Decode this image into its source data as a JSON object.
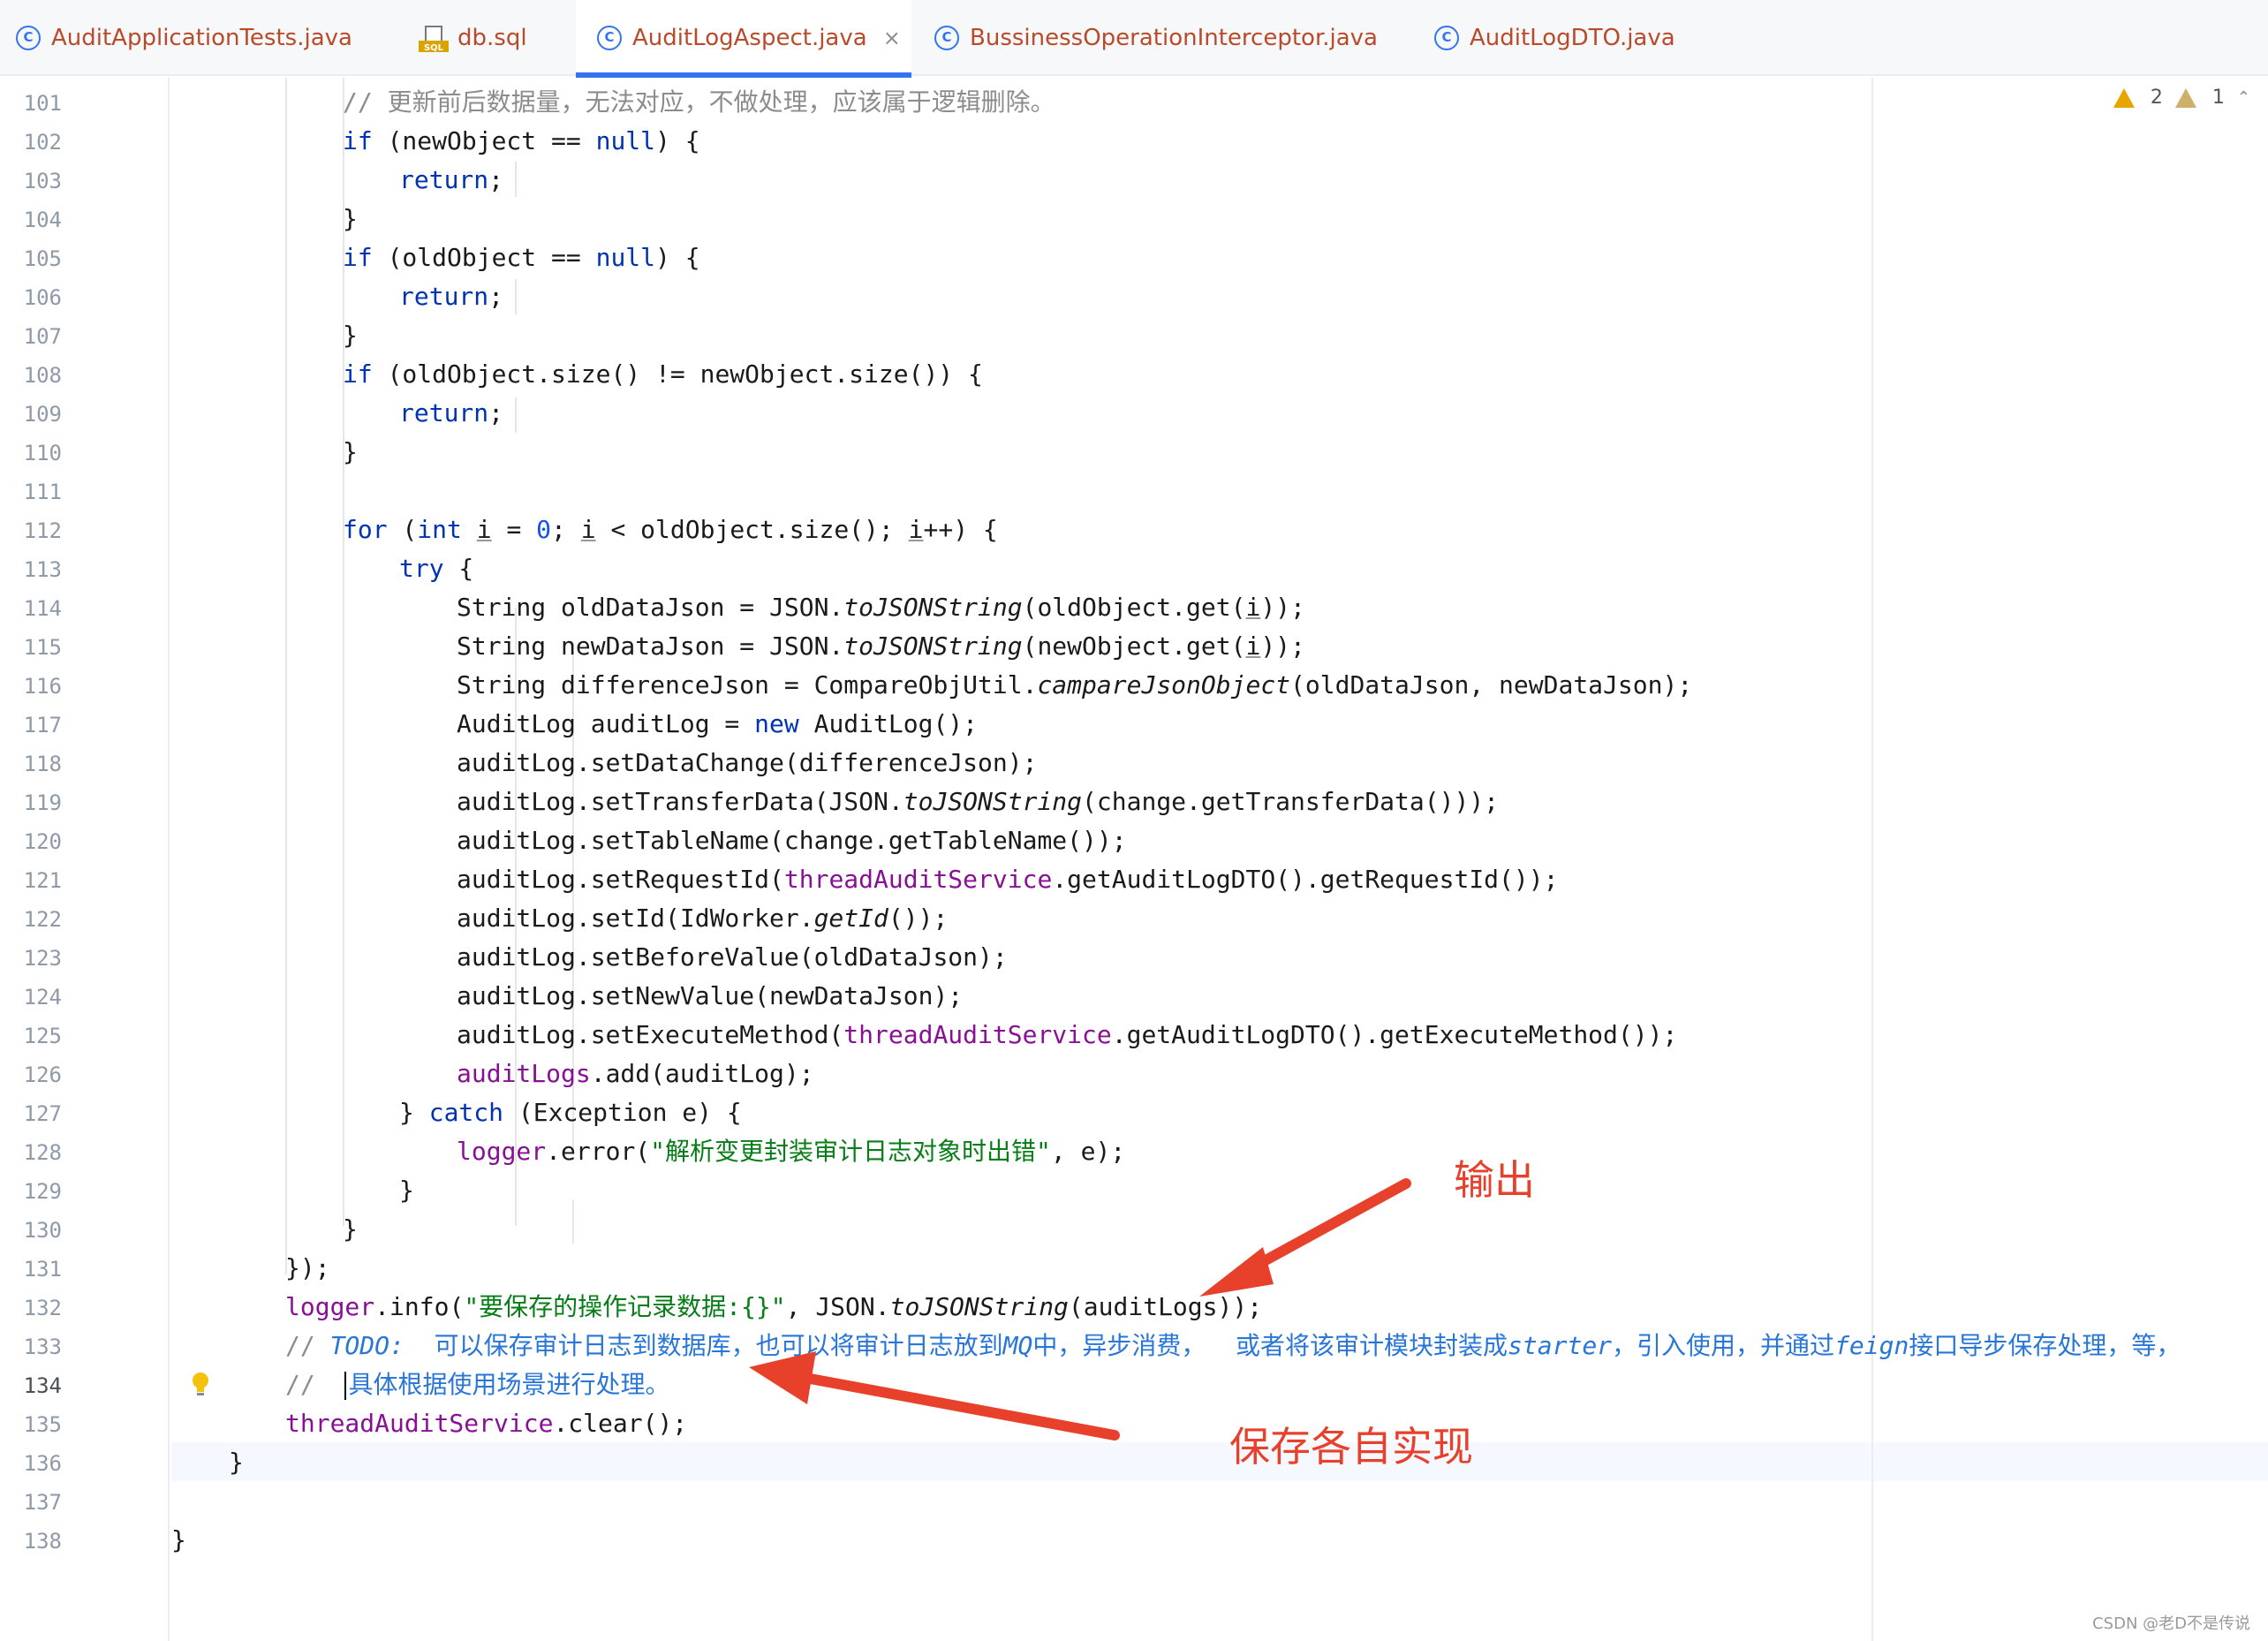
{
  "tabs": [
    {
      "label": "AuditApplicationTests.java",
      "icon": "class-icon",
      "active": false
    },
    {
      "label": "db.sql",
      "icon": "sql-file-icon",
      "active": false
    },
    {
      "label": "AuditLogAspect.java",
      "icon": "class-icon",
      "active": true
    },
    {
      "label": "BussinessOperationInterceptor.java",
      "icon": "class-icon",
      "active": false
    },
    {
      "label": "AuditLogDTO.java",
      "icon": "class-icon",
      "active": false
    }
  ],
  "class_icon_glyph": "C",
  "close_glyph": "×",
  "inspection": {
    "warnings": "2",
    "weak_warnings": "1"
  },
  "line_numbers": [
    "101",
    "102",
    "103",
    "104",
    "105",
    "106",
    "107",
    "108",
    "109",
    "110",
    "111",
    "112",
    "113",
    "114",
    "115",
    "116",
    "117",
    "118",
    "119",
    "120",
    "121",
    "122",
    "123",
    "124",
    "125",
    "126",
    "127",
    "128",
    "129",
    "130",
    "131",
    "132",
    "133",
    "134",
    "135",
    "136",
    "137",
    "138"
  ],
  "current_line": "134",
  "code": {
    "l101": "// 更新前后数据量，无法对应，不做处理，应该属于逻辑删除。",
    "l102a": "if",
    "l102b": " (newObject == ",
    "l102c": "null",
    "l102d": ") {",
    "l103": "return",
    "l103b": ";",
    "l104": "}",
    "l105a": "if",
    "l105b": " (oldObject == ",
    "l105c": "null",
    "l105d": ") {",
    "l106": "return",
    "l106b": ";",
    "l107": "}",
    "l108a": "if",
    "l108b": " (oldObject.size() != newObject.size()) {",
    "l109": "return",
    "l109b": ";",
    "l110": "}",
    "l112a": "for",
    "l112b": " (",
    "l112c": "int",
    "l112d": " ",
    "l112e": "i",
    "l112f": " = ",
    "l112g": "0",
    "l112h": "; ",
    "l112i": "i",
    "l112j": " < oldObject.size(); ",
    "l112k": "i",
    "l112l": "++) {",
    "l113a": "try",
    "l113b": " {",
    "l114a": "String oldDataJson = JSON.",
    "l114b": "toJSONString",
    "l114c": "(oldObject.get(",
    "l114d": "i",
    "l114e": "));",
    "l115a": "String newDataJson = JSON.",
    "l115b": "toJSONString",
    "l115c": "(newObject.get(",
    "l115d": "i",
    "l115e": "));",
    "l116a": "String differenceJson = CompareObjUtil.",
    "l116b": "campareJsonObject",
    "l116c": "(oldDataJson, newDataJson);",
    "l117a": "AuditLog auditLog = ",
    "l117b": "new",
    "l117c": " AuditLog();",
    "l118": "auditLog.setDataChange(differenceJson);",
    "l119a": "auditLog.setTransferData(JSON.",
    "l119b": "toJSONString",
    "l119c": "(change.getTransferData()));",
    "l120": "auditLog.setTableName(change.getTableName());",
    "l121a": "auditLog.setRequestId(",
    "l121b": "threadAuditService",
    "l121c": ".getAuditLogDTO().getRequestId());",
    "l122a": "auditLog.setId(IdWorker.",
    "l122b": "getId",
    "l122c": "());",
    "l123": "auditLog.setBeforeValue(oldDataJson);",
    "l124": "auditLog.setNewValue(newDataJson);",
    "l125a": "auditLog.setExecuteMethod(",
    "l125b": "threadAuditService",
    "l125c": ".getAuditLogDTO().getExecuteMethod());",
    "l126a": "auditLogs",
    "l126b": ".add(auditLog);",
    "l127a": "} ",
    "l127b": "catch",
    "l127c": " (Exception e) {",
    "l128a": "logger",
    "l128b": ".error(",
    "l128c": "\"解析变更封装审计日志对象时出错\"",
    "l128d": ", e);",
    "l129": "}",
    "l130": "}",
    "l131": "});",
    "l132a": "logger",
    "l132b": ".info(",
    "l132c": "\"要保存的操作记录数据:{}\"",
    "l132d": ", JSON.",
    "l132e": "toJSONString",
    "l132f": "(auditLogs));",
    "l133a": "// ",
    "l133b": "TODO:",
    "l133c": "  可以保存审计日志到数据库，也可以将审计日志放到",
    "l133d": "MQ",
    "l133e": "中，异步消费，  或者将该审计模块封装成",
    "l133f": "starter",
    "l133g": "，引入使用，并通过",
    "l133h": "feign",
    "l133i": "接口导步保存处理，等，",
    "l134a": "//  ",
    "l134b": "具体根据使用场景进行处理。",
    "l135a": "threadAuditService",
    "l135b": ".clear();",
    "l136": "}",
    "l138": "}"
  },
  "annotations": {
    "output_label": "输出",
    "save_label": "保存各自实现",
    "color": "#e8412b"
  },
  "watermark": "CSDN @老D不是传说"
}
